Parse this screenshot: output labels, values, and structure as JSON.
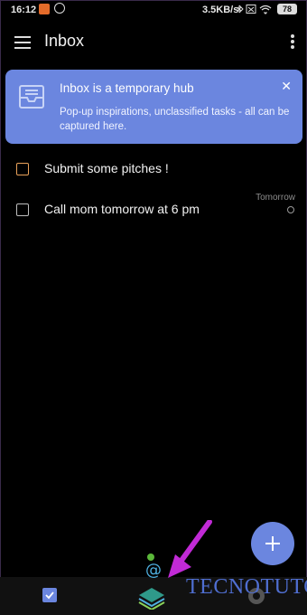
{
  "status_bar": {
    "time": "16:12",
    "speed": "3.5KB/s",
    "battery": "78"
  },
  "app_bar": {
    "title": "Inbox",
    "menu_icon": "hamburger-icon",
    "more_icon": "more-vert-icon"
  },
  "banner": {
    "heading": "Inbox is a temporary hub",
    "body": "Pop-up inspirations, unclassified tasks - all can be captured here.",
    "close_icon": "close-icon",
    "close_glyph": "✕",
    "color": "#6b86df"
  },
  "tasks": [
    {
      "label": "Submit some pitches !",
      "checkbox_color": "#e9a15a",
      "due": ""
    },
    {
      "label": "Call mom tomorrow at 6 pm",
      "checkbox_color": "#bdbdbd",
      "due": "Tomorrow"
    }
  ],
  "fab": {
    "icon": "plus-icon"
  },
  "bottom_nav": {
    "items": [
      "tasks-icon",
      "inbox-icon",
      "settings-icon"
    ]
  },
  "watermark": {
    "text": "TECNOTUTO"
  }
}
